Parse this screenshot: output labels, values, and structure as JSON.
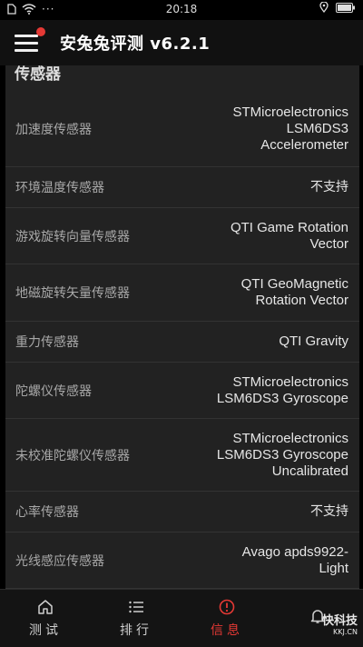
{
  "status": {
    "time": "20:18"
  },
  "app": {
    "title": "安兔兔评测 v6.2.1"
  },
  "section": {
    "title": "传感器"
  },
  "sensors": [
    {
      "label": "加速度传感器",
      "value": "STMicroelectronics\nLSM6DS3\nAccelerometer"
    },
    {
      "label": "环境温度传感器",
      "value": "不支持"
    },
    {
      "label": "游戏旋转向量传感器",
      "value": "QTI Game Rotation\nVector"
    },
    {
      "label": "地磁旋转矢量传感器",
      "value": "QTI GeoMagnetic\nRotation Vector"
    },
    {
      "label": "重力传感器",
      "value": "QTI Gravity"
    },
    {
      "label": "陀螺仪传感器",
      "value": "STMicroelectronics\nLSM6DS3 Gyroscope"
    },
    {
      "label": "未校准陀螺仪传感器",
      "value": "STMicroelectronics\nLSM6DS3 Gyroscope\nUncalibrated"
    },
    {
      "label": "心率传感器",
      "value": "不支持"
    },
    {
      "label": "光线感应传感器",
      "value": "Avago apds9922-\nLight"
    }
  ],
  "nav": [
    {
      "label": "测试",
      "icon": "home-icon"
    },
    {
      "label": "排行",
      "icon": "list-icon"
    },
    {
      "label": "信息",
      "icon": "info-icon"
    },
    {
      "label": "",
      "icon": "bell-icon"
    }
  ],
  "watermark": {
    "main": "快科技",
    "sub": "KKJ.CN"
  },
  "colors": {
    "accent": "#e53935",
    "content_bg": "#222222",
    "topbar_bg": "#111111"
  }
}
